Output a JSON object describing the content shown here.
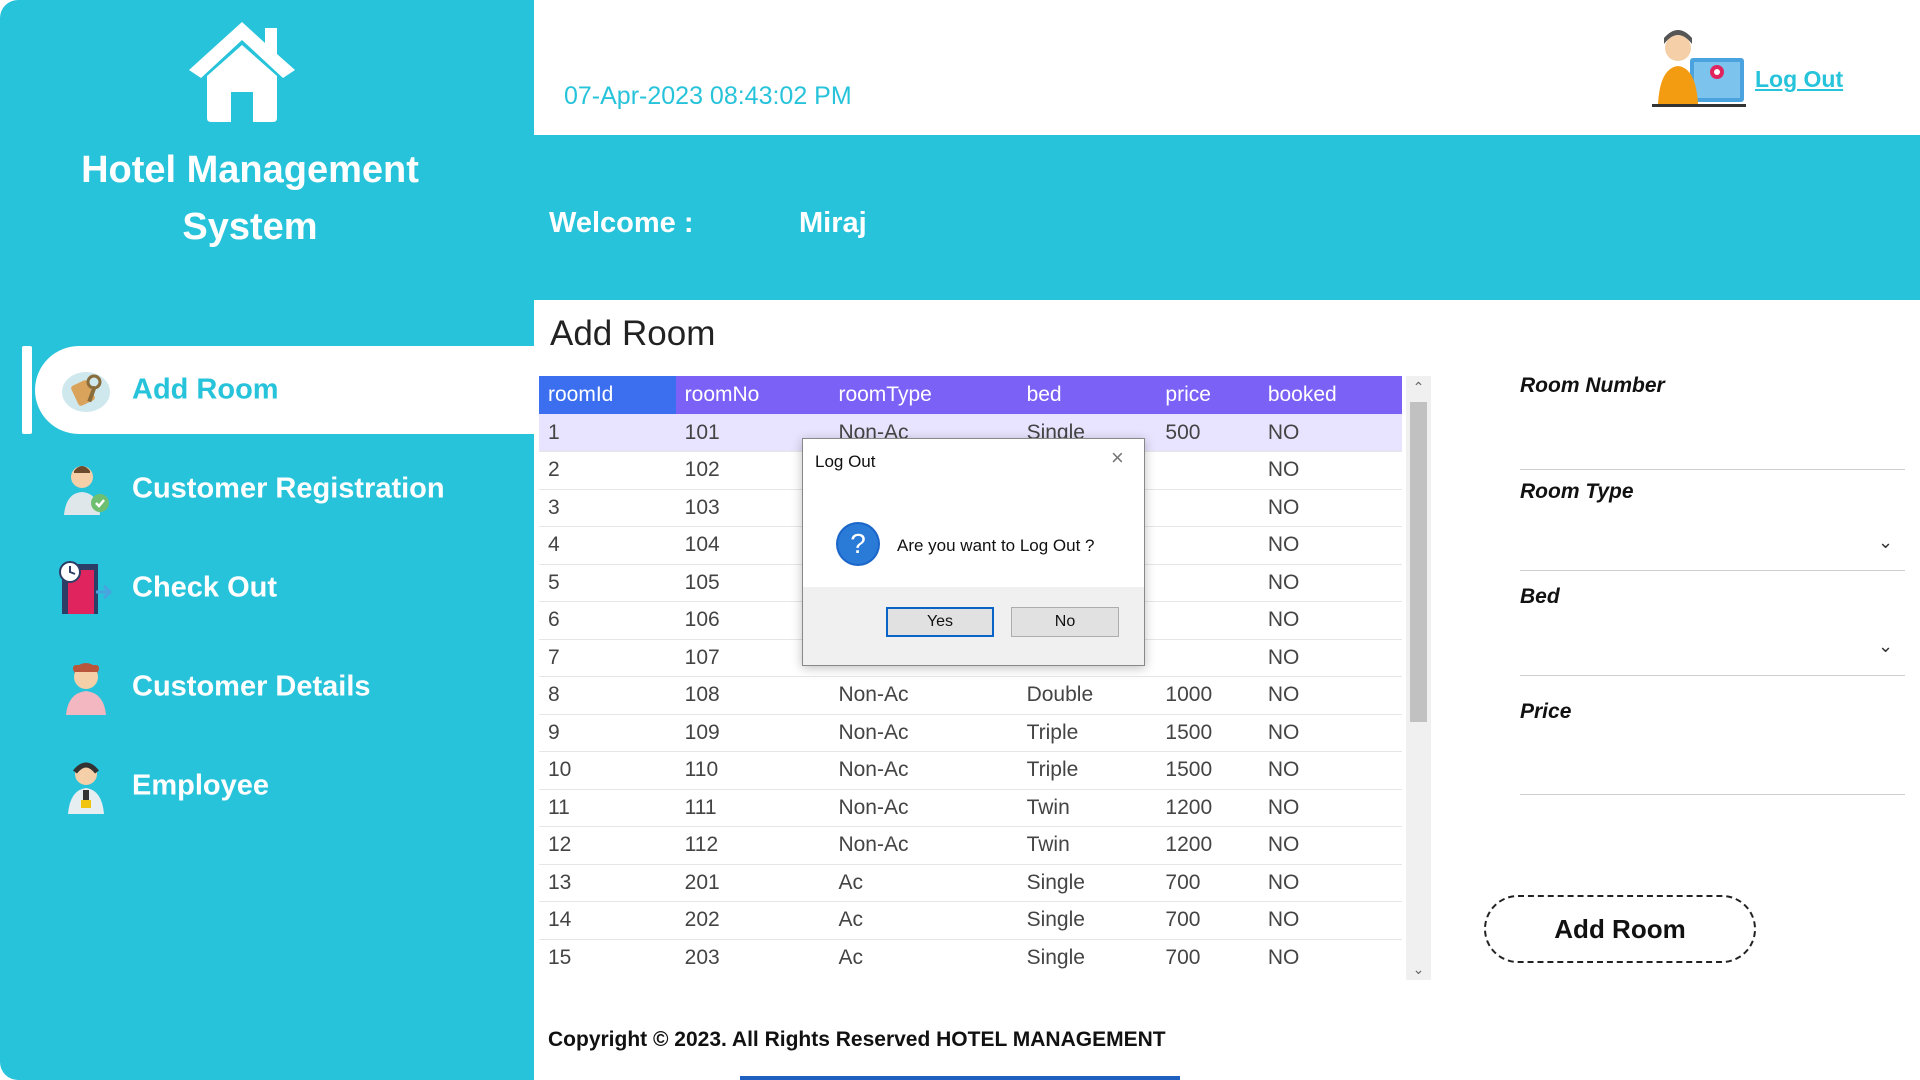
{
  "app": {
    "title_line1": "Hotel Management",
    "title_line2": "System"
  },
  "header": {
    "datetime": "07-Apr-2023 08:43:02 PM",
    "logout_label": "Log Out"
  },
  "welcome": {
    "label": "Welcome :",
    "name": "Miraj"
  },
  "sidebar": {
    "items": [
      {
        "label": "Add Room",
        "icon": "room-key-icon",
        "active": true
      },
      {
        "label": "Customer Registration",
        "icon": "customer-registration-icon"
      },
      {
        "label": "Check Out",
        "icon": "checkout-door-icon"
      },
      {
        "label": "Customer Details",
        "icon": "customer-details-icon"
      },
      {
        "label": "Employee",
        "icon": "employee-icon"
      }
    ]
  },
  "main": {
    "title": "Add Room",
    "table": {
      "columns": [
        "roomId",
        "roomNo",
        "roomType",
        "bed",
        "price",
        "booked"
      ],
      "rows": [
        [
          "1",
          "101",
          "Non-Ac",
          "Single",
          "500",
          "NO"
        ],
        [
          "2",
          "102",
          "",
          "",
          "",
          "NO"
        ],
        [
          "3",
          "103",
          "",
          "",
          "",
          "NO"
        ],
        [
          "4",
          "104",
          "",
          "",
          "",
          "NO"
        ],
        [
          "5",
          "105",
          "",
          "",
          "",
          "NO"
        ],
        [
          "6",
          "106",
          "",
          "",
          "",
          "NO"
        ],
        [
          "7",
          "107",
          "",
          "",
          "",
          "NO"
        ],
        [
          "8",
          "108",
          "Non-Ac",
          "Double",
          "1000",
          "NO"
        ],
        [
          "9",
          "109",
          "Non-Ac",
          "Triple",
          "1500",
          "NO"
        ],
        [
          "10",
          "110",
          "Non-Ac",
          "Triple",
          "1500",
          "NO"
        ],
        [
          "11",
          "111",
          "Non-Ac",
          "Twin",
          "1200",
          "NO"
        ],
        [
          "12",
          "112",
          "Non-Ac",
          "Twin",
          "1200",
          "NO"
        ],
        [
          "13",
          "201",
          "Ac",
          "Single",
          "700",
          "NO"
        ],
        [
          "14",
          "202",
          "Ac",
          "Single",
          "700",
          "NO"
        ],
        [
          "15",
          "203",
          "Ac",
          "Single",
          "700",
          "NO"
        ]
      ]
    }
  },
  "form": {
    "room_number_label": "Room Number",
    "room_type_label": "Room Type",
    "bed_label": "Bed",
    "price_label": "Price",
    "add_button": "Add Room"
  },
  "footer": {
    "copyright": "Copyright © 2023. All Rights Reserved HOTEL MANAGEMENT"
  },
  "dialog": {
    "title": "Log Out",
    "message": "Are you want to Log Out ?",
    "yes": "Yes",
    "no": "No"
  },
  "colors": {
    "accent": "#27c3da",
    "header_row": "#7b61f5",
    "selected_header": "#3b6ff0"
  }
}
